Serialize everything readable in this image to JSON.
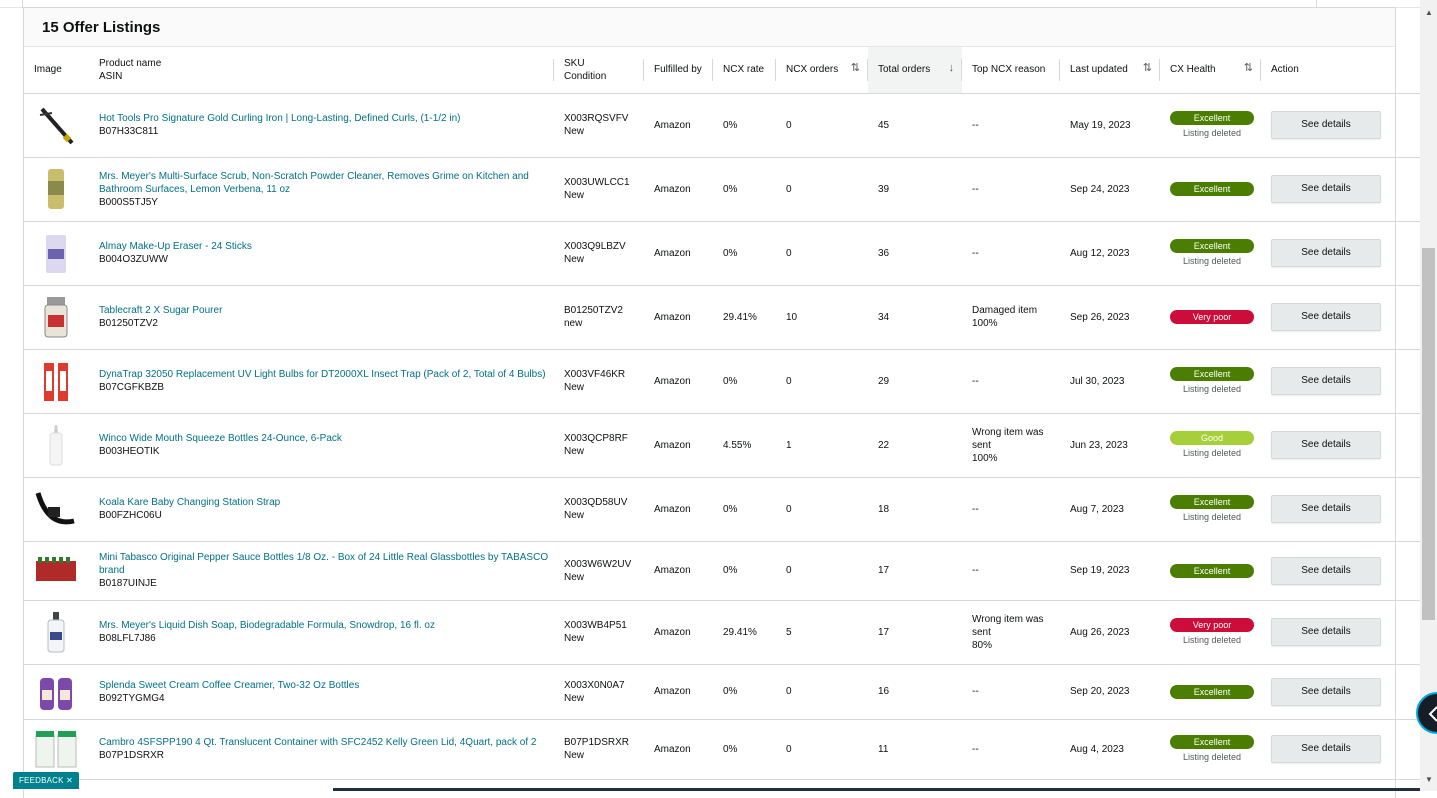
{
  "header": {
    "title": "15 Offer Listings"
  },
  "columns": {
    "image": "Image",
    "product_name": "Product name",
    "asin": "ASIN",
    "sku": "SKU",
    "condition": "Condition",
    "fulfilled_by": "Fulfilled by",
    "ncx_rate": "NCX rate",
    "ncx_orders": "NCX orders",
    "total_orders": "Total orders",
    "top_ncx_reason": "Top NCX reason",
    "last_updated": "Last updated",
    "cx_health": "CX Health",
    "action": "Action"
  },
  "colors": {
    "excellent": "#4b7d00",
    "very_poor": "#cc0c39",
    "good": "#a6d03a",
    "link": "#007185"
  },
  "rows": [
    {
      "product": "Hot Tools Pro Signature Gold Curling Iron | Long-Lasting, Defined Curls, (1-1/2 in)",
      "asin": "B07H33C811",
      "sku": "X003RQSVFV",
      "condition": "New",
      "fulfilled": "Amazon",
      "ncx_rate": "0%",
      "ncx_orders": "0",
      "total": "45",
      "reason1": "--",
      "reason2": "",
      "reason3": "",
      "updated": "May 19, 2023",
      "health": "Excellent",
      "health_type": "excellent",
      "status": "Listing deleted",
      "action": "See details",
      "icon": "curling-iron-icon"
    },
    {
      "product": "Mrs. Meyer's Multi-Surface Scrub, Non-Scratch Powder Cleaner, Removes Grime on Kitchen and Bathroom Surfaces, Lemon Verbena, 11 oz",
      "asin": "B000S5TJ5Y",
      "sku": "X003UWLCC1",
      "condition": "New",
      "fulfilled": "Amazon",
      "ncx_rate": "0%",
      "ncx_orders": "0",
      "total": "39",
      "reason1": "--",
      "reason2": "",
      "reason3": "",
      "updated": "Sep 24, 2023",
      "health": "Excellent",
      "health_type": "excellent",
      "status": "",
      "action": "See details",
      "icon": "cleaner-can-icon"
    },
    {
      "product": "Almay Make-Up Eraser - 24 Sticks",
      "asin": "B004O3ZUWW",
      "sku": "X003Q9LBZV",
      "condition": "New",
      "fulfilled": "Amazon",
      "ncx_rate": "0%",
      "ncx_orders": "0",
      "total": "36",
      "reason1": "--",
      "reason2": "",
      "reason3": "",
      "updated": "Aug 12, 2023",
      "health": "Excellent",
      "health_type": "excellent",
      "status": "Listing deleted",
      "action": "See details",
      "icon": "makeup-eraser-icon"
    },
    {
      "product": "Tablecraft 2 X Sugar Pourer",
      "asin": "B01250TZV2",
      "sku": "B01250TZV2",
      "condition": "new",
      "fulfilled": "Amazon",
      "ncx_rate": "29.41%",
      "ncx_orders": "10",
      "total": "34",
      "reason1": "Damaged item",
      "reason2": "100%",
      "reason3": "",
      "updated": "Sep 26, 2023",
      "health": "Very poor",
      "health_type": "very_poor",
      "status": "",
      "action": "See details",
      "icon": "sugar-pourer-icon"
    },
    {
      "product": "DynaTrap 32050 Replacement UV Light Bulbs for DT2000XL Insect Trap (Pack of 2, Total of 4 Bulbs)",
      "asin": "B07CGFKBZB",
      "sku": "X003VF46KR",
      "condition": "New",
      "fulfilled": "Amazon",
      "ncx_rate": "0%",
      "ncx_orders": "0",
      "total": "29",
      "reason1": "--",
      "reason2": "",
      "reason3": "",
      "updated": "Jul 30, 2023",
      "health": "Excellent",
      "health_type": "excellent",
      "status": "Listing deleted",
      "action": "See details",
      "icon": "light-bulbs-icon"
    },
    {
      "product": "Winco Wide Mouth Squeeze Bottles 24-Ounce, 6-Pack",
      "asin": "B003HEOTIK",
      "sku": "X003QCP8RF",
      "condition": "New",
      "fulfilled": "Amazon",
      "ncx_rate": "4.55%",
      "ncx_orders": "1",
      "total": "22",
      "reason1": "Wrong item was",
      "reason2": "sent",
      "reason3": "100%",
      "updated": "Jun 23, 2023",
      "health": "Good",
      "health_type": "good",
      "status": "Listing deleted",
      "action": "See details",
      "icon": "squeeze-bottle-icon"
    },
    {
      "product": "Koala Kare Baby Changing Station Strap",
      "asin": "B00FZHC06U",
      "sku": "X003QD58UV",
      "condition": "New",
      "fulfilled": "Amazon",
      "ncx_rate": "0%",
      "ncx_orders": "0",
      "total": "18",
      "reason1": "--",
      "reason2": "",
      "reason3": "",
      "updated": "Aug 7, 2023",
      "health": "Excellent",
      "health_type": "excellent",
      "status": "Listing deleted",
      "action": "See details",
      "icon": "strap-icon"
    },
    {
      "product": "Mini Tabasco Original Pepper Sauce Bottles 1/8 Oz. - Box of 24 Little Real Glassbottles by TABASCO brand",
      "asin": "B0187UINJE",
      "sku": "X003W6W2UV",
      "condition": "New",
      "fulfilled": "Amazon",
      "ncx_rate": "0%",
      "ncx_orders": "0",
      "total": "17",
      "reason1": "--",
      "reason2": "",
      "reason3": "",
      "updated": "Sep 19, 2023",
      "health": "Excellent",
      "health_type": "excellent",
      "status": "",
      "action": "See details",
      "icon": "tabasco-bottles-icon"
    },
    {
      "product": "Mrs. Meyer's Liquid Dish Soap, Biodegradable Formula, Snowdrop, 16 fl. oz",
      "asin": "B08LFL7J86",
      "sku": "X003WB4P51",
      "condition": "New",
      "fulfilled": "Amazon",
      "ncx_rate": "29.41%",
      "ncx_orders": "5",
      "total": "17",
      "reason1": "Wrong item was",
      "reason2": "sent",
      "reason3": "80%",
      "updated": "Aug 26, 2023",
      "health": "Very poor",
      "health_type": "very_poor",
      "status": "Listing deleted",
      "action": "See details",
      "icon": "dish-soap-icon"
    },
    {
      "product": "Splenda Sweet Cream Coffee Creamer, Two-32 Oz Bottles",
      "asin": "B092TYGMG4",
      "sku": "X003X0N0A7",
      "condition": "New",
      "fulfilled": "Amazon",
      "ncx_rate": "0%",
      "ncx_orders": "0",
      "total": "16",
      "reason1": "--",
      "reason2": "",
      "reason3": "",
      "updated": "Sep 20, 2023",
      "health": "Excellent",
      "health_type": "excellent",
      "status": "",
      "action": "See details",
      "icon": "creamer-bottles-icon"
    },
    {
      "product": "Cambro 4SFSPP190 4 Qt. Translucent Container with SFC2452 Kelly Green Lid, 4Quart, pack of 2",
      "asin": "B07P1DSRXR",
      "sku": "B07P1DSRXR",
      "condition": "New",
      "fulfilled": "Amazon",
      "ncx_rate": "0%",
      "ncx_orders": "0",
      "total": "11",
      "reason1": "--",
      "reason2": "",
      "reason3": "",
      "updated": "Aug 4, 2023",
      "health": "Excellent",
      "health_type": "excellent",
      "status": "Listing deleted",
      "action": "See details",
      "icon": "container-icon"
    }
  ],
  "row_heights": [
    64,
    64,
    64,
    64,
    64,
    64,
    64,
    59,
    64,
    55,
    60
  ],
  "feedback": {
    "label": "FEEDBACK ✕"
  }
}
